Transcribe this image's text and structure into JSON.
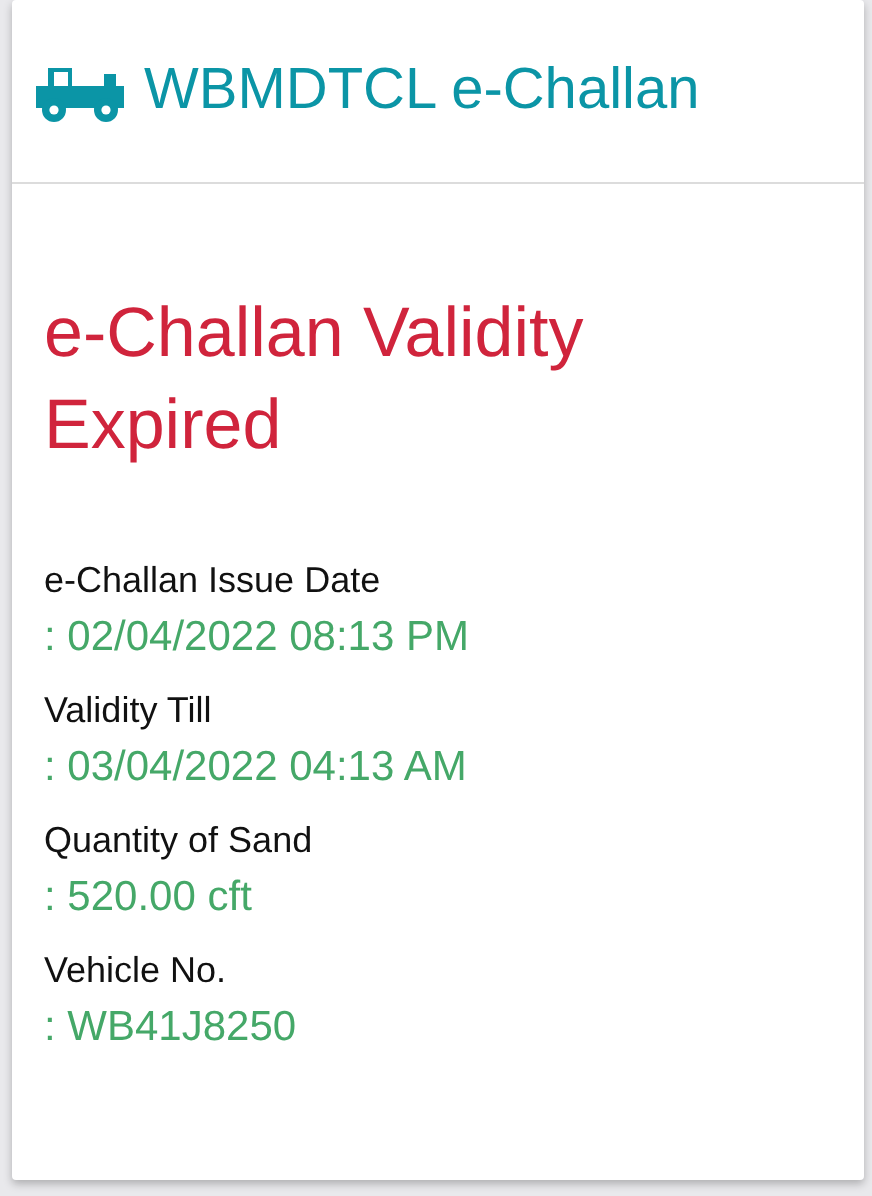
{
  "header": {
    "title": "WBMDTCL e-Challan"
  },
  "status": {
    "message": "e-Challan Validity Expired"
  },
  "fields": [
    {
      "label": "e-Challan Issue Date",
      "value": ": 02/04/2022 08:13 PM"
    },
    {
      "label": "Validity Till",
      "value": ": 03/04/2022 04:13 AM"
    },
    {
      "label": "Quantity of Sand",
      "value": ": 520.00 cft"
    },
    {
      "label": "Vehicle No.",
      "value": ": WB41J8250"
    }
  ]
}
